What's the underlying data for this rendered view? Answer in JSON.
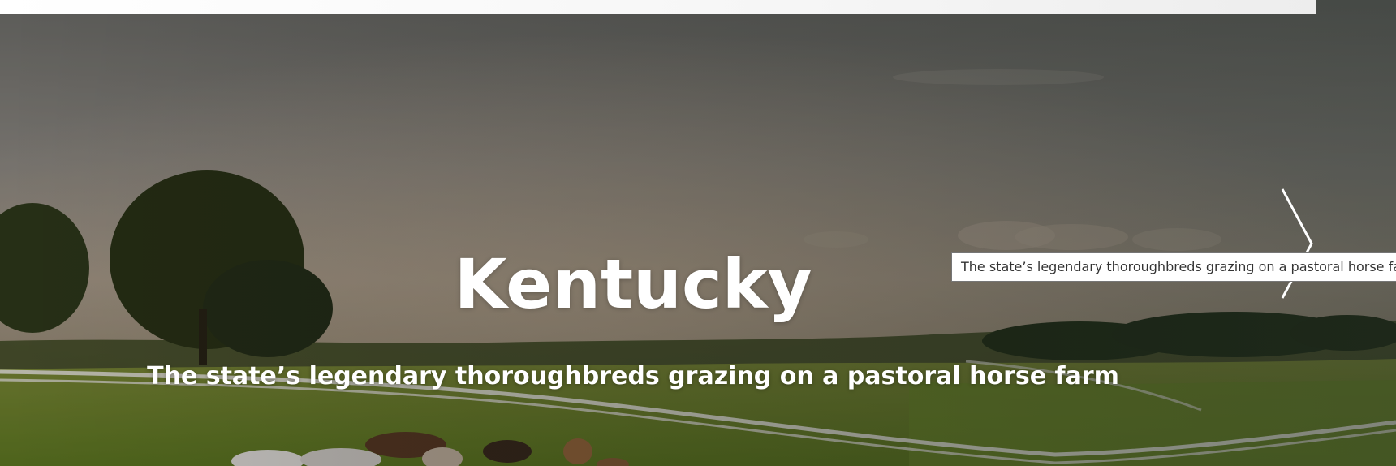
{
  "hero": {
    "title": "Kentucky",
    "subtitle": "The state’s legendary thoroughbreds grazing on a pastoral horse farm",
    "tooltip": "The state’s legendary thoroughbreds grazing on a pastoral horse farm",
    "next_icon": "chevron-right-icon"
  },
  "colors": {
    "text": "#ffffff",
    "tooltip_border": "#767676",
    "topbar": "#f2f2f2"
  }
}
